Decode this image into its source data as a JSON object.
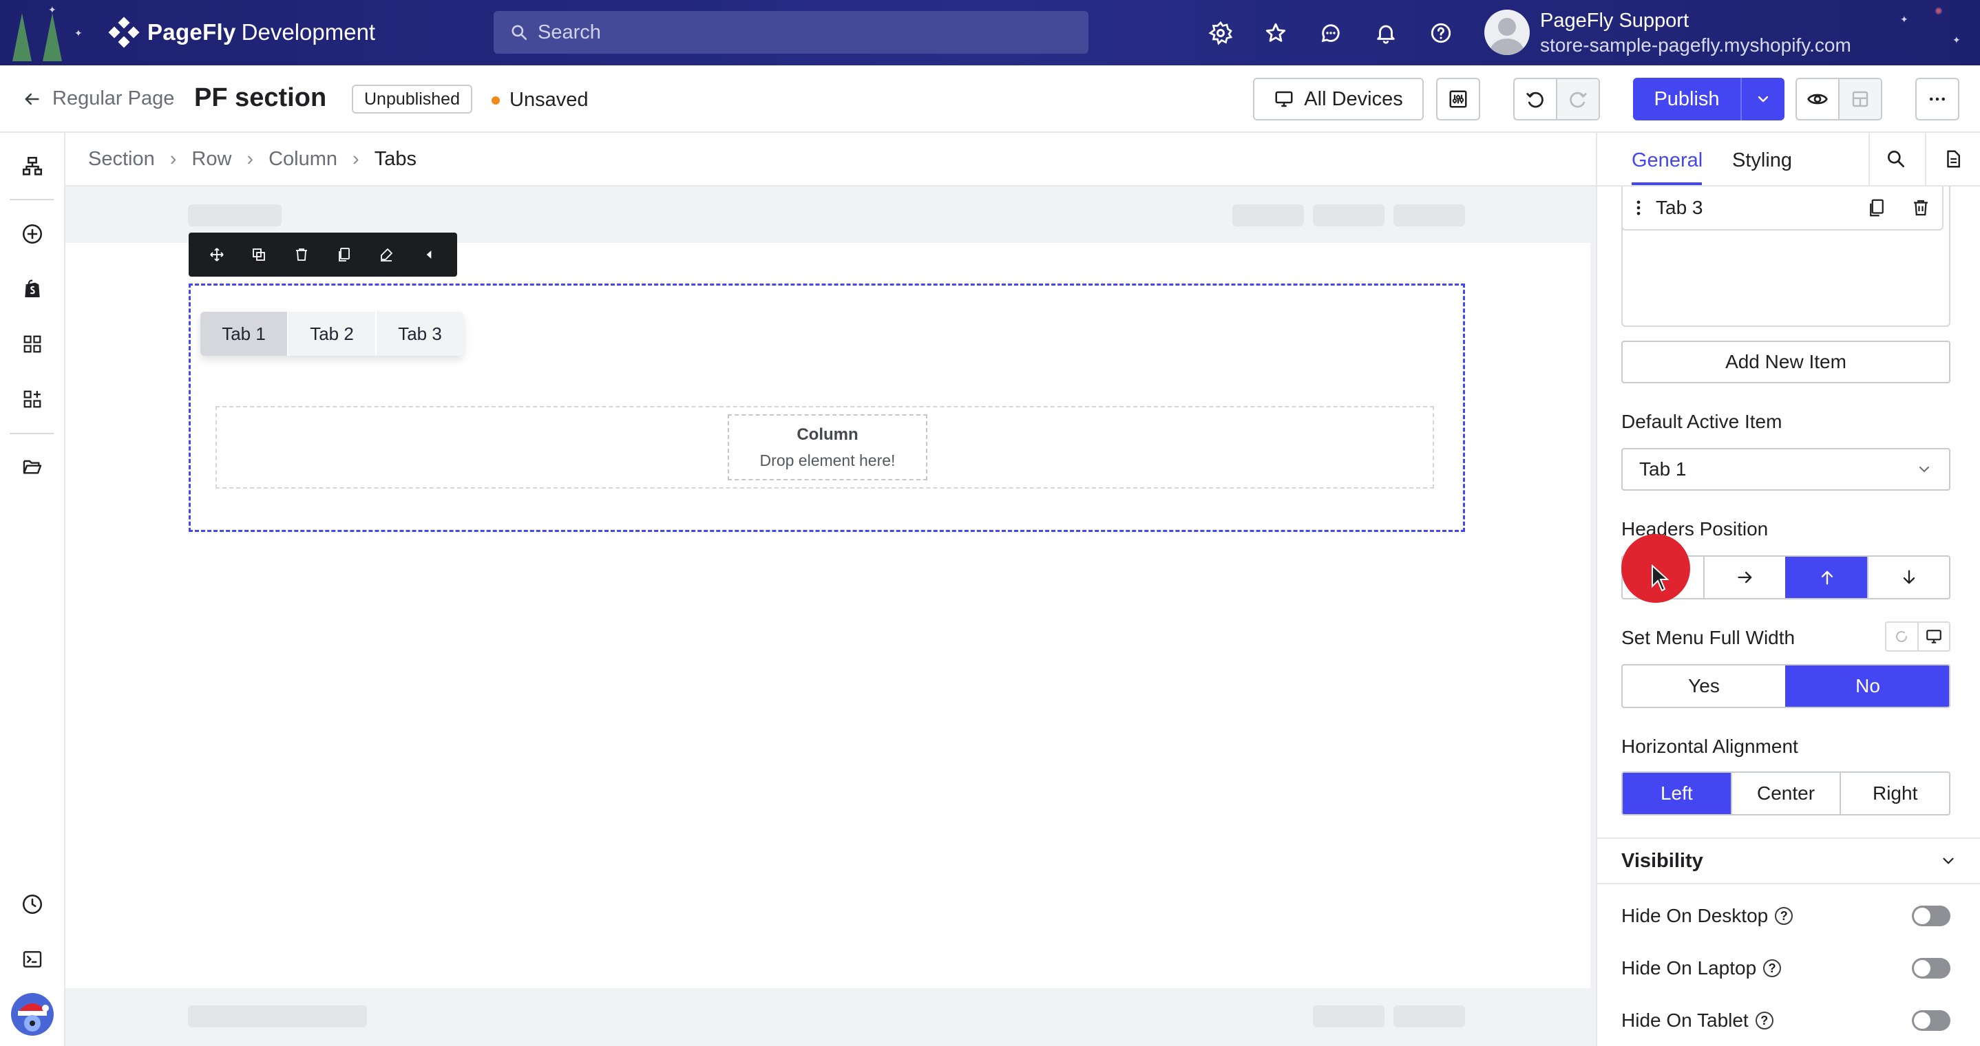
{
  "topbar": {
    "brand": "PageFly",
    "brand_sub": "Development",
    "search_placeholder": "Search",
    "user_name": "PageFly Support",
    "user_store": "store-sample-pagefly.myshopify.com"
  },
  "header": {
    "back_label": "Regular Page",
    "title": "PF section",
    "status_badge": "Unpublished",
    "save_state": "Unsaved",
    "devices_label": "All Devices",
    "publish_label": "Publish"
  },
  "breadcrumb": [
    "Section",
    "Row",
    "Column",
    "Tabs"
  ],
  "canvas": {
    "tabs": [
      "Tab 1",
      "Tab 2",
      "Tab 3"
    ],
    "column_title": "Column",
    "column_hint": "Drop element here!"
  },
  "panel": {
    "tab_general": "General",
    "tab_styling": "Styling",
    "list_item": "Tab 3",
    "add_new_item": "Add New Item",
    "default_active_label": "Default Active Item",
    "default_active_value": "Tab 1",
    "headers_position_label": "Headers Position",
    "menu_full_width_label": "Set Menu Full Width",
    "menu_full_width_options": [
      "Yes",
      "No"
    ],
    "horizontal_alignment_label": "Horizontal Alignment",
    "horizontal_alignment_options": [
      "Left",
      "Center",
      "Right"
    ],
    "visibility_label": "Visibility",
    "hide_desktop": "Hide On Desktop",
    "hide_laptop": "Hide On Laptop",
    "hide_tablet": "Hide On Tablet"
  },
  "colors": {
    "accent": "#4446f1",
    "topbar": "#23277a",
    "unsaved_dot": "#f08a1a",
    "cursor_highlight": "#e0242f"
  }
}
